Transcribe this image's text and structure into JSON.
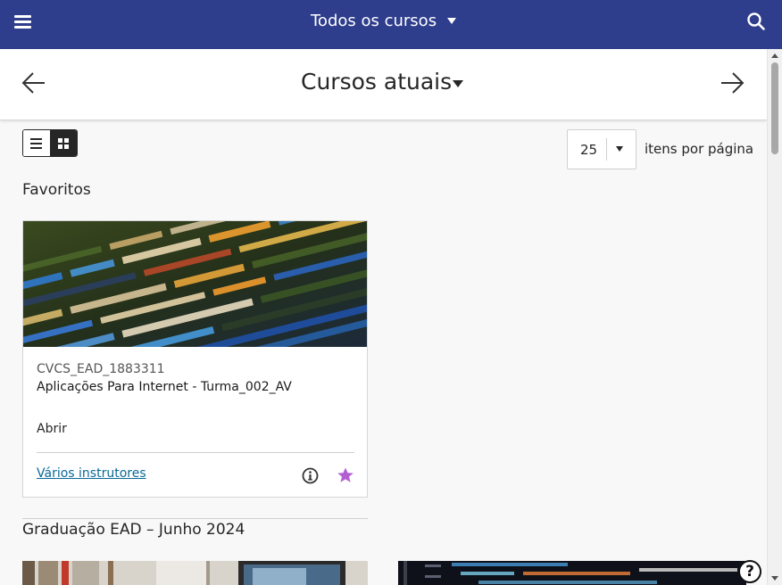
{
  "topbar": {
    "title": "Todos os cursos",
    "menu_icon": "hamburger-menu-icon",
    "search_icon": "search-icon",
    "background": "#2e3d8c"
  },
  "subheader": {
    "title": "Cursos atuais",
    "prev_icon": "arrow-left-icon",
    "next_icon": "arrow-right-icon"
  },
  "view_toggle": {
    "list_icon": "list-view-icon",
    "grid_icon": "grid-view-icon",
    "active": "grid"
  },
  "pagination": {
    "per_page_value": "25",
    "per_page_label": "itens por página"
  },
  "sections": [
    {
      "title": "Favoritos",
      "courses": [
        {
          "code": "CVCS_EAD_1883311",
          "name": "Aplicações Para Internet - Turma_002_AV",
          "status": "Abrir",
          "instructors": "Vários instrutores",
          "image": "code-editor-image",
          "info_icon": "info-icon",
          "favorite_icon": "star-icon",
          "favorite_color": "#b25fd1"
        }
      ]
    },
    {
      "title": "Graduação EAD – Junho 2024",
      "courses": [
        {
          "image": "office-desk-image"
        },
        {
          "image": "code-screen-image"
        }
      ]
    }
  ],
  "help_icon": "help-icon"
}
